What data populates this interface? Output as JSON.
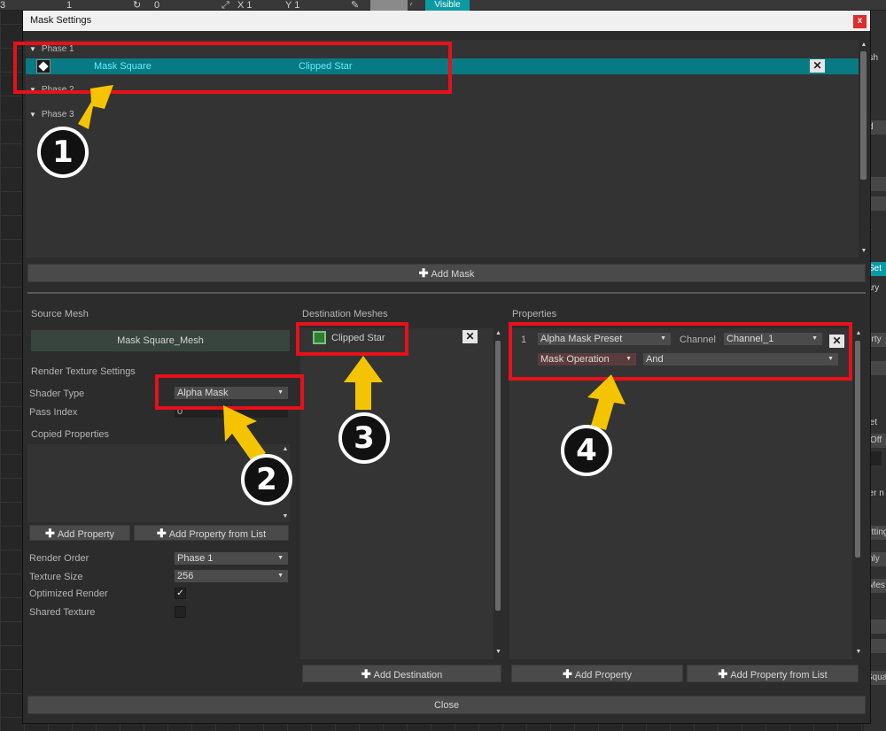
{
  "background": {
    "toolbar": [
      {
        "label": "3"
      },
      {
        "label": "1"
      },
      {
        "label": "0"
      },
      {
        "label": "X 1"
      },
      {
        "label": "Y 1"
      }
    ],
    "visible_button": "Visible",
    "right_panel": [
      "esh",
      "d",
      "et",
      "Set",
      "rary",
      "erty",
      "Set",
      "Off",
      "ner n",
      "etting",
      "nly",
      "Mes",
      "Squa"
    ]
  },
  "dialog": {
    "title": "Mask Settings",
    "close_glyph": "x",
    "phases": [
      {
        "label": "Phase 1"
      },
      {
        "label": "Phase 2"
      },
      {
        "label": "Phase 3"
      }
    ],
    "mask_row": {
      "source": "Mask Square",
      "destination": "Clipped Star",
      "delete_glyph": "✕"
    },
    "add_mask_label": "Add Mask",
    "source": {
      "header": "Source Mesh",
      "mesh_name": "Mask Square_Mesh",
      "render_texture_header": "Render Texture Settings",
      "shader_type_label": "Shader Type",
      "shader_type_value": "Alpha Mask",
      "pass_index_label": "Pass Index",
      "pass_index_value": "0",
      "copied_properties_header": "Copied Properties",
      "add_property_label": "Add Property",
      "add_property_list_label": "Add Property from List",
      "render_order_label": "Render Order",
      "render_order_value": "Phase 1",
      "texture_size_label": "Texture Size",
      "texture_size_value": "256",
      "optimized_render_label": "Optimized Render",
      "optimized_render_checked": true,
      "shared_texture_label": "Shared Texture",
      "shared_texture_checked": false
    },
    "destination": {
      "header": "Destination Meshes",
      "items": [
        {
          "name": "Clipped Star"
        }
      ],
      "add_destination_label": "Add Destination"
    },
    "properties": {
      "header": "Properties",
      "rows": [
        {
          "index": "1",
          "preset": "Alpha Mask Preset",
          "channel_label": "Channel",
          "channel_value": "Channel_1",
          "operation_label": "Mask Operation",
          "operation_value": "And"
        }
      ],
      "add_property_label": "Add Property",
      "add_property_list_label": "Add Property from List"
    },
    "close_label": "Close"
  },
  "annotations": {
    "badges": [
      "1",
      "2",
      "3",
      "4"
    ],
    "colors": {
      "highlight": "#e8101a",
      "arrow": "#f5c400"
    }
  }
}
